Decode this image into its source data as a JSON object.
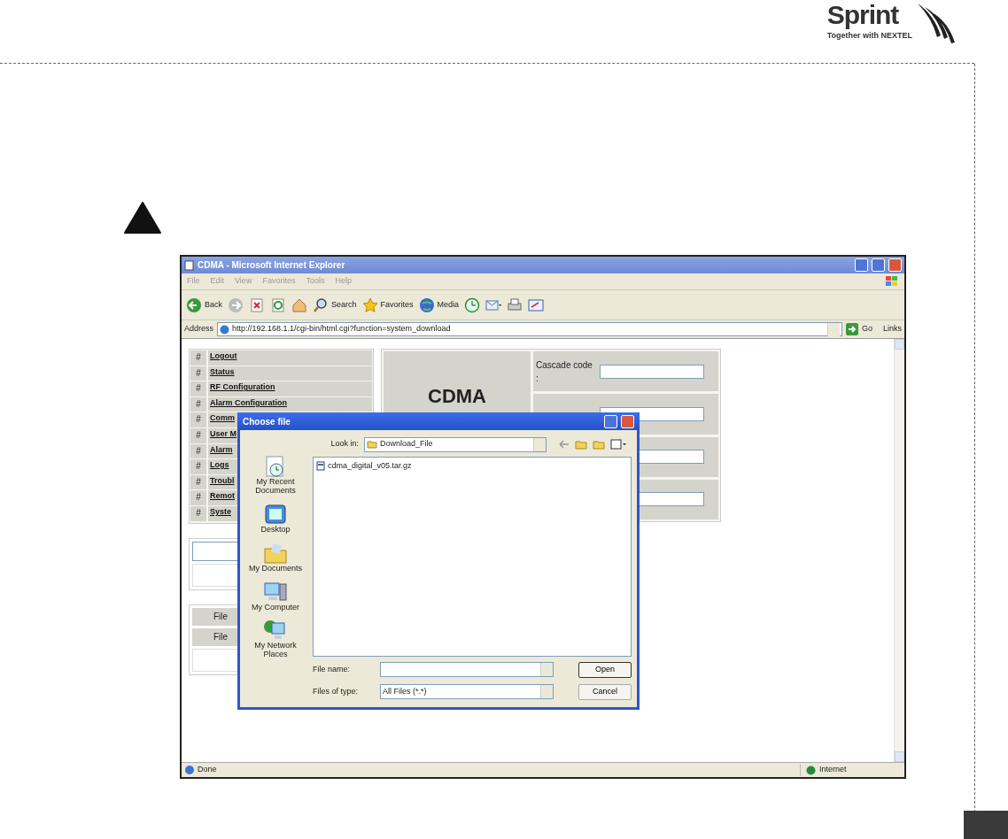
{
  "header": {
    "logo_word": "Sprint",
    "logo_tagline": "Together with NEXTEL"
  },
  "browser": {
    "title": "CDMA - Microsoft Internet Explorer",
    "menu": [
      "File",
      "Edit",
      "View",
      "Favorites",
      "Tools",
      "Help"
    ],
    "toolbar": [
      {
        "kind": "back",
        "label": "Back"
      },
      {
        "kind": "forward"
      },
      {
        "kind": "stop"
      },
      {
        "kind": "refresh"
      },
      {
        "kind": "home"
      },
      {
        "kind": "search",
        "label": "Search"
      },
      {
        "kind": "favorites",
        "label": "Favorites"
      },
      {
        "kind": "media",
        "label": "Media"
      },
      {
        "kind": "history"
      },
      {
        "kind": "mail"
      },
      {
        "kind": "print"
      },
      {
        "kind": "edit"
      }
    ],
    "address_label": "Address",
    "url": "http://192.168.1.1/cgi-bin/html.cgi?function=system_download",
    "go": "Go",
    "links": "Links",
    "status": "Done",
    "zone": "Internet"
  },
  "page": {
    "nav": [
      {
        "mark": "#",
        "label": "Logout"
      },
      {
        "mark": "#",
        "label": "Status"
      },
      {
        "mark": "#",
        "label": "RF Configuration"
      },
      {
        "mark": "#",
        "label": "Alarm Configuration"
      },
      {
        "mark": "#",
        "label": "Comm"
      },
      {
        "mark": "#",
        "label": "User M"
      },
      {
        "mark": "#",
        "label": "Alarm"
      },
      {
        "mark": "#",
        "label": "Logs"
      },
      {
        "mark": "#",
        "label": "Troubl"
      },
      {
        "mark": "#",
        "label": "Remot"
      },
      {
        "mark": "#",
        "label": "Syste"
      }
    ],
    "panel_title": "CDMA",
    "cascade_label": "Cascade code :",
    "file_cells": [
      "File",
      "File"
    ]
  },
  "dialog": {
    "title": "Choose file",
    "look_in_label": "Look in:",
    "look_in": "Download_File",
    "places": [
      {
        "kind": "recent",
        "label": "My Recent Documents"
      },
      {
        "kind": "desktop",
        "label": "Desktop"
      },
      {
        "kind": "documents",
        "label": "My Documents"
      },
      {
        "kind": "computer",
        "label": "My Computer"
      },
      {
        "kind": "network",
        "label": "My Network Places"
      }
    ],
    "files": [
      {
        "name": "cdma_digital_v05.tar.gz",
        "selected": false
      }
    ],
    "file_name_label": "File name:",
    "file_type_label": "Files of type:",
    "file_type": "All Files (*.*)",
    "buttons": [
      "Open",
      "Cancel"
    ]
  }
}
